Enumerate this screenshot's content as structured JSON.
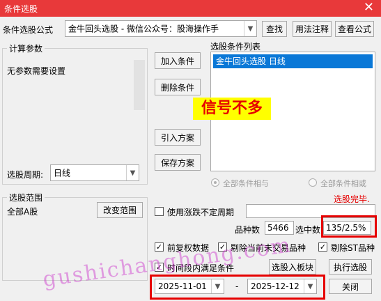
{
  "window": {
    "title": "条件选股",
    "close_glyph": "✕"
  },
  "formula": {
    "label": "条件选股公式",
    "selected": "金牛回头选股  -  微信公众号：股海操作手",
    "find_button": "查找",
    "usage_button": "用法注释",
    "view_button": "查看公式"
  },
  "params": {
    "title": "计算参数",
    "no_params_text": "无参数需要设置",
    "period_label": "选股周期:",
    "period_value": "日线"
  },
  "condition_buttons": {
    "add": "加入条件",
    "delete": "删除条件",
    "import": "引入方案",
    "save": "保存方案"
  },
  "condition_list": {
    "title": "选股条件列表",
    "items": [
      "金牛回头选股  日线"
    ]
  },
  "overlay_text": "信号不多",
  "logic": {
    "and_label": "全部条件相与",
    "or_label": "全部条件相或"
  },
  "status": {
    "done_text": "选股完毕."
  },
  "scope": {
    "title": "选股范围",
    "value": "全部A股",
    "change_button": "改变范围"
  },
  "options": {
    "variable_period_label": "使用涨跌不定周期",
    "variable_period_checked": false,
    "adjusted_label": "前复权数据",
    "adjusted_checked": true,
    "exclude_untraded_label": "剔除当前未交易品种",
    "exclude_untraded_checked": true,
    "exclude_st_label": "剔除ST品种",
    "exclude_st_checked": true,
    "time_range_label": "时间段内满足条件",
    "time_range_checked": true
  },
  "stats": {
    "count_label": "品种数",
    "count_value": "5466",
    "selected_label": "选中数",
    "selected_value": "135/2.5%"
  },
  "actions": {
    "to_block": "选股入板块",
    "execute": "执行选股",
    "close": "关闭"
  },
  "dates": {
    "start": "2025-11-01",
    "separator": "-",
    "end": "2025-12-12"
  },
  "watermark": "gushichanghong.com",
  "colors": {
    "title_bar": "#e8393a",
    "selection": "#0a78d7",
    "highlight_box": "#e60000",
    "overlay_text": "#e60000",
    "overlay_bg": "#ffff00",
    "status": "#e60000",
    "watermark": "#cc33cc"
  }
}
